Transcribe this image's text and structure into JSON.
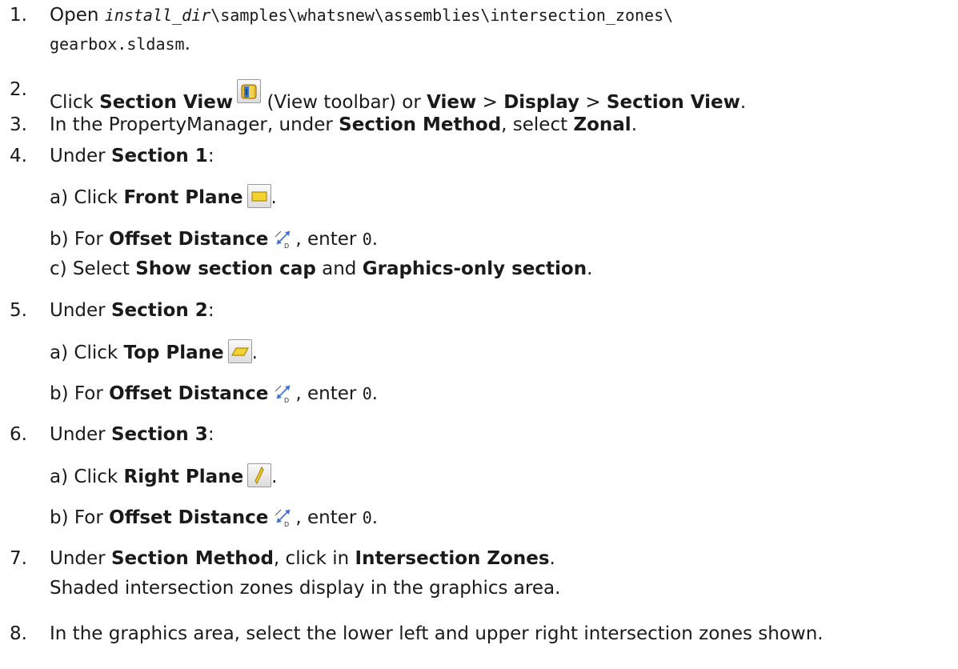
{
  "steps": {
    "s1": {
      "num": "1.",
      "open": "Open",
      "path_italic": "install_dir",
      "path_rest": "\\samples\\whatsnew\\assemblies\\intersection_zones\\",
      "path_line2": "gearbox.sldasm",
      "end": "."
    },
    "s2": {
      "num": "2.",
      "click": "Click",
      "section_view": "Section View",
      "toolbar": "(View toolbar) or",
      "view": "View",
      "gt1": ">",
      "display": "Display",
      "gt2": ">",
      "section_view2": "Section View",
      "end": "."
    },
    "s3": {
      "num": "3.",
      "text1": "In the PropertyManager, under",
      "section_method": "Section Method",
      "text2": ", select",
      "zonal": "Zonal",
      "end": "."
    },
    "s4": {
      "num": "4.",
      "under": "Under",
      "section": "Section 1",
      "colon": ":",
      "a_pre": "a) Click",
      "a_bold": "Front Plane",
      "a_end": ".",
      "b_pre": "b) For",
      "b_bold": "Offset Distance",
      "b_mid": ", enter",
      "b_val": "0",
      "b_end": ".",
      "c_pre": "c) Select",
      "c_bold1": "Show section cap",
      "c_and": "and",
      "c_bold2": "Graphics-only section",
      "c_end": "."
    },
    "s5": {
      "num": "5.",
      "under": "Under",
      "section": "Section 2",
      "colon": ":",
      "a_pre": "a) Click",
      "a_bold": "Top Plane",
      "a_end": ".",
      "b_pre": "b) For",
      "b_bold": "Offset Distance",
      "b_mid": ", enter",
      "b_val": "0",
      "b_end": "."
    },
    "s6": {
      "num": "6.",
      "under": "Under",
      "section": "Section 3",
      "colon": ":",
      "a_pre": "a) Click",
      "a_bold": "Right Plane",
      "a_end": ".",
      "b_pre": "b) For",
      "b_bold": "Offset Distance",
      "b_mid": ", enter",
      "b_val": "0",
      "b_end": "."
    },
    "s7": {
      "num": "7.",
      "under": "Under",
      "section_method": "Section Method",
      "text": ", click in",
      "zones": "Intersection Zones",
      "end": ".",
      "line2": "Shaded intersection zones display in the graphics area."
    },
    "s8": {
      "num": "8.",
      "text": "In the graphics area, select the lower left and upper right intersection zones shown."
    }
  },
  "icons": {
    "section_view": "section-view-icon",
    "front_plane": "front-plane-icon",
    "top_plane": "top-plane-icon",
    "right_plane": "right-plane-icon",
    "offset_distance": "offset-distance-icon"
  }
}
